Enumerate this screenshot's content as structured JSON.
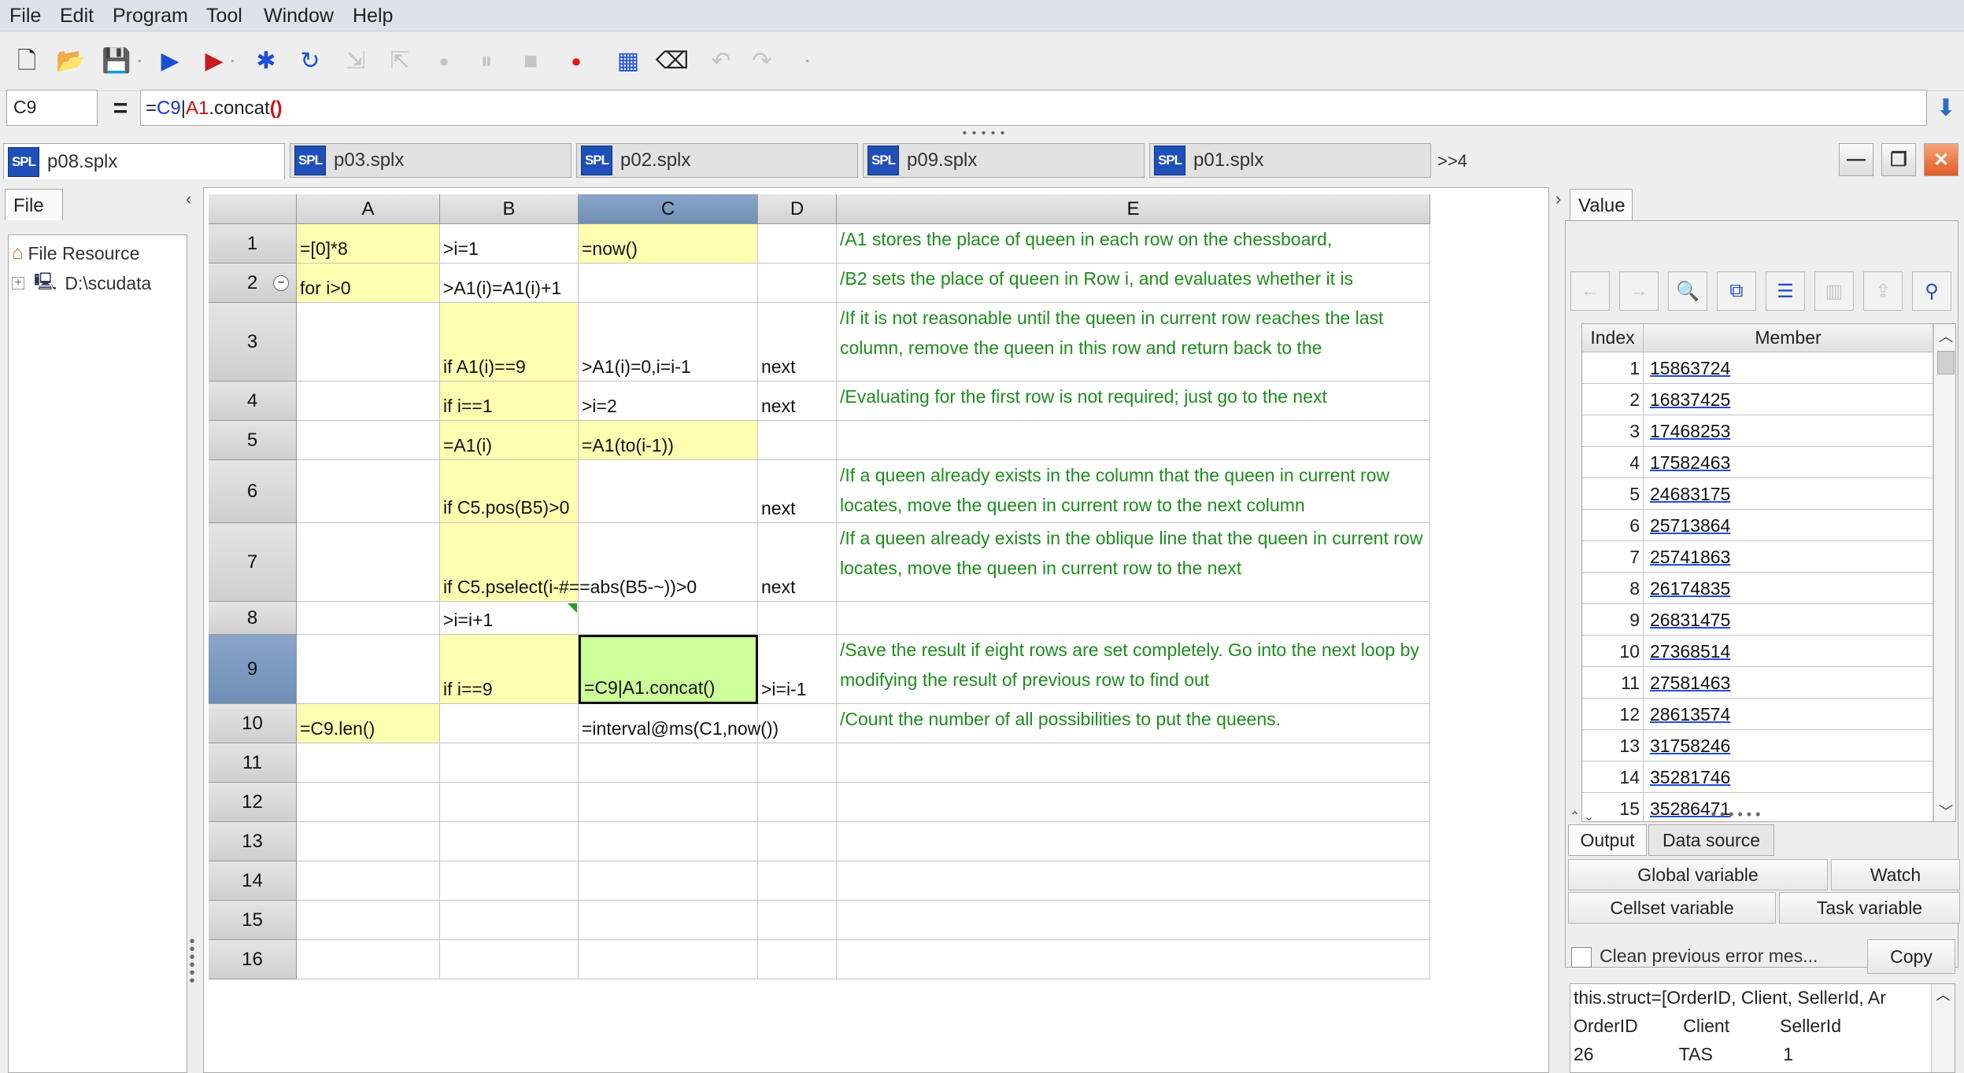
{
  "menu": [
    "File",
    "Edit",
    "Program",
    "Tool",
    "Window",
    "Help"
  ],
  "toolbar": [
    {
      "icon": "new-file-icon",
      "glyph": "🗋",
      "enabled": true
    },
    {
      "icon": "open-folder-icon",
      "glyph": "📂",
      "enabled": true
    },
    {
      "icon": "save-icon",
      "glyph": "💾",
      "enabled": false
    },
    {
      "icon": "run-icon",
      "glyph": "▶",
      "enabled": true
    },
    {
      "icon": "debug-run-icon",
      "glyph": "▶",
      "enabled": true
    },
    {
      "icon": "execute-to-cursor-icon",
      "glyph": "✱",
      "enabled": true
    },
    {
      "icon": "step-over-icon",
      "glyph": "↻",
      "enabled": true
    },
    {
      "icon": "step-into-icon",
      "glyph": "⇲",
      "enabled": false
    },
    {
      "icon": "step-return-icon",
      "glyph": "⇱",
      "enabled": false
    },
    {
      "icon": "cursor-icon",
      "glyph": "●",
      "enabled": false
    },
    {
      "icon": "pause-icon",
      "glyph": "⏸",
      "enabled": false
    },
    {
      "icon": "stop-icon",
      "glyph": "■",
      "enabled": false
    },
    {
      "icon": "breakpoint-icon",
      "glyph": "●",
      "enabled": true
    },
    {
      "icon": "calculator-icon",
      "glyph": "▦",
      "enabled": true
    },
    {
      "icon": "clear-icon",
      "glyph": "⌫",
      "enabled": true
    },
    {
      "icon": "undo-icon",
      "glyph": "↶",
      "enabled": false
    },
    {
      "icon": "redo-icon",
      "glyph": "↷",
      "enabled": false
    }
  ],
  "formula_bar": {
    "cell_ref": "C9",
    "eq": "=",
    "f_eq": "=",
    "f_c9": "C9",
    "f_pipe": "|",
    "f_a1": "A1",
    "f_rest": ".concat",
    "f_parens": "()"
  },
  "tabs": {
    "badge": "SPL",
    "files": [
      "p08.splx",
      "p03.splx",
      "p02.splx",
      "p09.splx",
      "p01.splx"
    ],
    "more": ">>4"
  },
  "left_panel": {
    "tab": "File",
    "tree": [
      "File Resource",
      "D:\\scudata"
    ]
  },
  "grid": {
    "columns": [
      "A",
      "B",
      "C",
      "D",
      "E"
    ],
    "rows": [
      "1",
      "2",
      "3",
      "4",
      "5",
      "6",
      "7",
      "8",
      "9",
      "10",
      "11",
      "12",
      "13",
      "14",
      "15",
      "16"
    ],
    "cells": {
      "A1": "=[0]*8",
      "B1": ">i=1",
      "C1": "=now()",
      "E1": "/A1 stores the place of queen in each row on the chessboard,",
      "A2": "for i>0",
      "B2": ">A1(i)=A1(i)+1",
      "E2": "/B2 sets the place of queen in Row i, and evaluates whether it is",
      "B3": "if A1(i)==9",
      "C3": ">A1(i)=0,i=i-1",
      "D3": "next",
      "E3": "/If it is not reasonable until the queen in current row reaches the last column, remove the queen in this row and return back to the",
      "B4": "if i==1",
      "C4": ">i=2",
      "D4": "next",
      "E4": "/Evaluating for the first row is not required; just go to the next",
      "B5": "=A1(i)",
      "C5": "=A1(to(i-1))",
      "B6": "if C5.pos(B5)>0",
      "D6": "next",
      "E6": "/If a queen already exists in the column that the queen in current row locates, move the queen in current row to the next column",
      "B7": "if C5.pselect(i-#==abs(B5-~))>0",
      "D7": "next",
      "E7": "/If a queen already exists in the oblique line that the queen in current row locates, move the queen in current row to the next",
      "B8": ">i=i+1",
      "B9": "if i==9",
      "C9": "=C9|A1.concat()",
      "D9": ">i=i-1",
      "E9": "/Save the result if eight rows are set completely. Go into the next loop by modifying the result of previous row to find out",
      "A10": "=C9.len()",
      "C10": "=interval@ms(C1,now())",
      "E10": "/Count the number of all possibilities to put the queens."
    },
    "selected_cell": "C9"
  },
  "value_panel": {
    "tab": "Value",
    "headers": [
      "Index",
      "Member"
    ],
    "rows": [
      {
        "index": "1",
        "member": "15863724"
      },
      {
        "index": "2",
        "member": "16837425"
      },
      {
        "index": "3",
        "member": "17468253"
      },
      {
        "index": "4",
        "member": "17582463"
      },
      {
        "index": "5",
        "member": "24683175"
      },
      {
        "index": "6",
        "member": "25713864"
      },
      {
        "index": "7",
        "member": "25741863"
      },
      {
        "index": "8",
        "member": "26174835"
      },
      {
        "index": "9",
        "member": "26831475"
      },
      {
        "index": "10",
        "member": "27368514"
      },
      {
        "index": "11",
        "member": "27581463"
      },
      {
        "index": "12",
        "member": "28613574"
      },
      {
        "index": "13",
        "member": "31758246"
      },
      {
        "index": "14",
        "member": "35281746"
      },
      {
        "index": "15",
        "member": "35286471"
      }
    ],
    "tools": [
      {
        "icon": "back-icon",
        "glyph": "←",
        "state": "dis"
      },
      {
        "icon": "forward-icon",
        "glyph": "→",
        "state": "dis"
      },
      {
        "icon": "preview-icon",
        "glyph": "🔍",
        "state": "dis"
      },
      {
        "icon": "copy-value-icon",
        "glyph": "⧉",
        "state": "on"
      },
      {
        "icon": "list-view-icon",
        "glyph": "☰",
        "state": "on"
      },
      {
        "icon": "chart-icon",
        "glyph": "▥",
        "state": "dis"
      },
      {
        "icon": "export-icon",
        "glyph": "⇪",
        "state": "dis"
      },
      {
        "icon": "pin-icon",
        "glyph": "⚲",
        "state": "on"
      }
    ]
  },
  "bottom_panel": {
    "tabs": [
      "Output",
      "Data source"
    ],
    "buttons": [
      "Global variable",
      "Watch",
      "Cellset variable",
      "Task variable"
    ],
    "clean_label": "Clean previous error mes...",
    "copy_label": "Copy",
    "output_lines": [
      "this.struct=[OrderID, Client, SellerId, Ar",
      "OrderID         Client          SellerId",
      "26                 TAS              1"
    ]
  }
}
